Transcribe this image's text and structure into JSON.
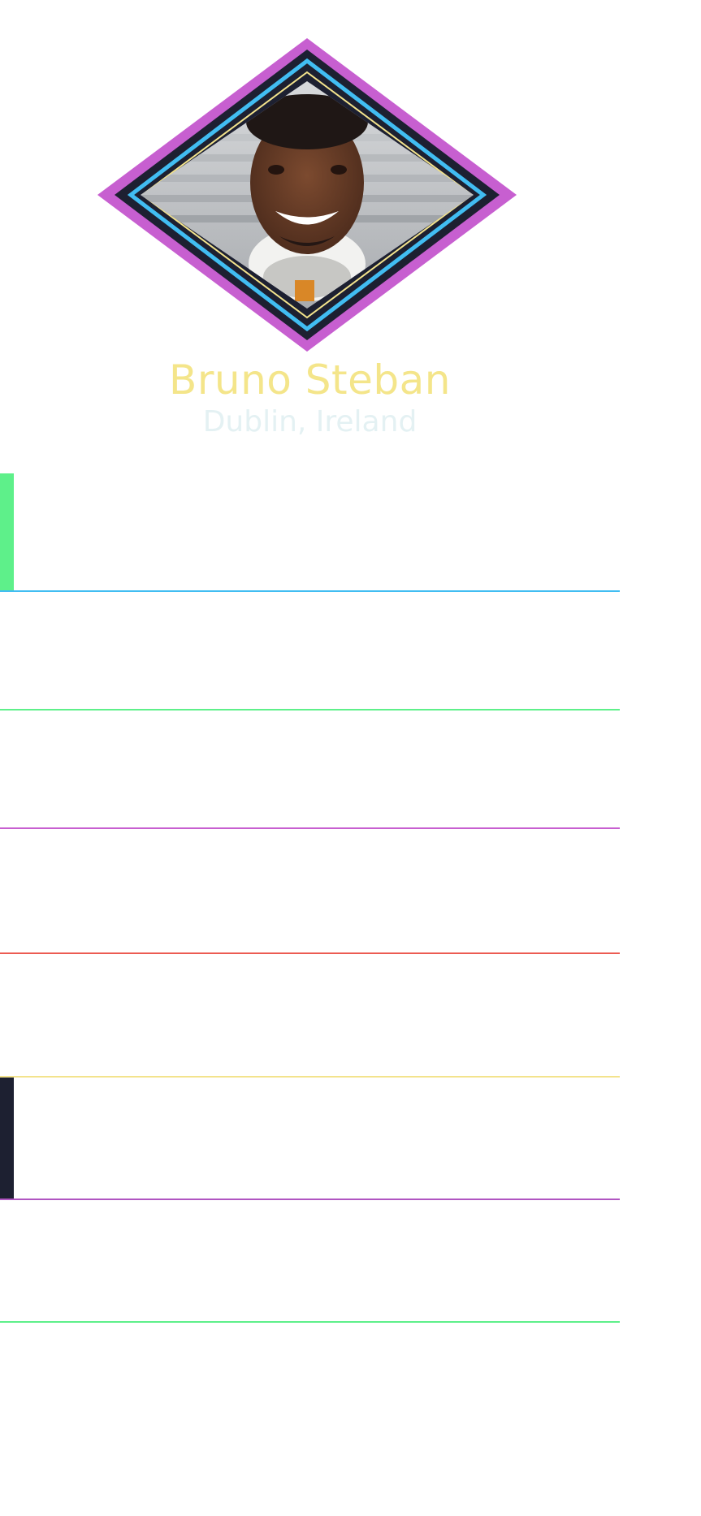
{
  "profile": {
    "name": "Bruno Steban",
    "location": "Dublin, Ireland",
    "avatar_icon": "profile-photo",
    "frame_colors": {
      "outer": "#c75fd0",
      "dark": "#1d2031",
      "blue": "#41bdf2",
      "yellow": "#f3e38c"
    }
  },
  "colors": {
    "name_text": "#f4e58a",
    "location_text": "#e4f1f3",
    "active_indicator": "#5ef08a",
    "secondary_indicator": "#1d2031"
  },
  "menu": {
    "items": [
      {
        "id": "item-1",
        "label": "",
        "line_color": "#41bdf2",
        "indicator": "#5ef08a",
        "active": true
      },
      {
        "id": "item-2",
        "label": "",
        "line_color": "#5ef08a",
        "indicator": "",
        "active": false
      },
      {
        "id": "item-3",
        "label": "",
        "line_color": "#c75fd0",
        "indicator": "",
        "active": false
      },
      {
        "id": "item-4",
        "label": "",
        "line_color": "#ec5b52",
        "indicator": "",
        "active": false
      },
      {
        "id": "item-5",
        "label": "",
        "line_color": "#f3e38c",
        "indicator": "",
        "active": false
      },
      {
        "id": "item-6",
        "label": "",
        "line_color": "#b055c1",
        "indicator": "#1d2031",
        "active": false
      },
      {
        "id": "item-7",
        "label": "",
        "line_color": "#5ef08a",
        "indicator": "",
        "active": false
      }
    ]
  }
}
